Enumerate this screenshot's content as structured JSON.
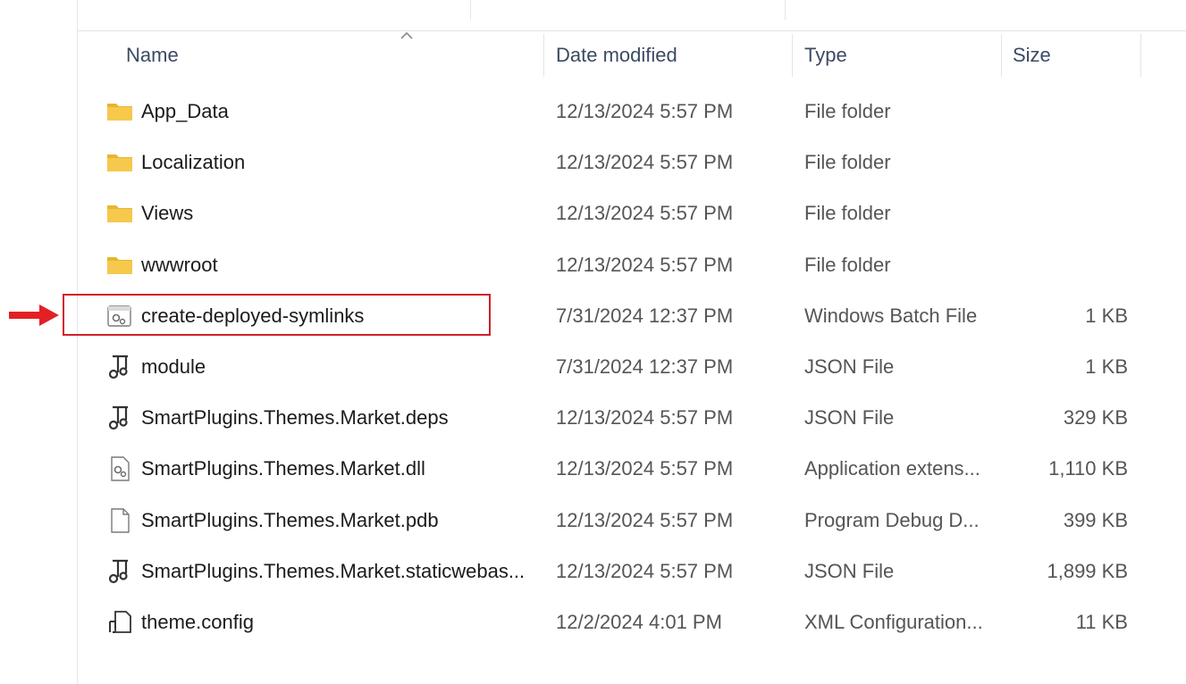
{
  "columns": {
    "name": "Name",
    "date_modified": "Date modified",
    "type": "Type",
    "size": "Size"
  },
  "colors": {
    "folder": "#f4c542",
    "highlight": "#d0202a",
    "arrow": "#e32024",
    "header_text": "#3b4a63"
  },
  "files": [
    {
      "icon": "folder-icon",
      "name": "App_Data",
      "date": "12/13/2024 5:57 PM",
      "type": "File folder",
      "size": ""
    },
    {
      "icon": "folder-icon",
      "name": "Localization",
      "date": "12/13/2024 5:57 PM",
      "type": "File folder",
      "size": ""
    },
    {
      "icon": "folder-icon",
      "name": "Views",
      "date": "12/13/2024 5:57 PM",
      "type": "File folder",
      "size": ""
    },
    {
      "icon": "folder-icon",
      "name": "wwwroot",
      "date": "12/13/2024 5:57 PM",
      "type": "File folder",
      "size": ""
    },
    {
      "icon": "batch-file-icon",
      "name": "create-deployed-symlinks",
      "date": "7/31/2024 12:37 PM",
      "type": "Windows Batch File",
      "size": "1 KB"
    },
    {
      "icon": "json-file-icon",
      "name": "module",
      "date": "7/31/2024 12:37 PM",
      "type": "JSON File",
      "size": "1 KB"
    },
    {
      "icon": "json-file-icon",
      "name": "SmartPlugins.Themes.Market.deps",
      "date": "12/13/2024 5:57 PM",
      "type": "JSON File",
      "size": "329 KB"
    },
    {
      "icon": "dll-file-icon",
      "name": "SmartPlugins.Themes.Market.dll",
      "date": "12/13/2024 5:57 PM",
      "type": "Application extens...",
      "size": "1,110 KB"
    },
    {
      "icon": "blank-file-icon",
      "name": "SmartPlugins.Themes.Market.pdb",
      "date": "12/13/2024 5:57 PM",
      "type": "Program Debug D...",
      "size": "399 KB"
    },
    {
      "icon": "json-file-icon",
      "name": "SmartPlugins.Themes.Market.staticwebas...",
      "date": "12/13/2024 5:57 PM",
      "type": "JSON File",
      "size": "1,899 KB"
    },
    {
      "icon": "config-file-icon",
      "name": "theme.config",
      "date": "12/2/2024 4:01 PM",
      "type": "XML Configuration...",
      "size": "11 KB"
    }
  ]
}
